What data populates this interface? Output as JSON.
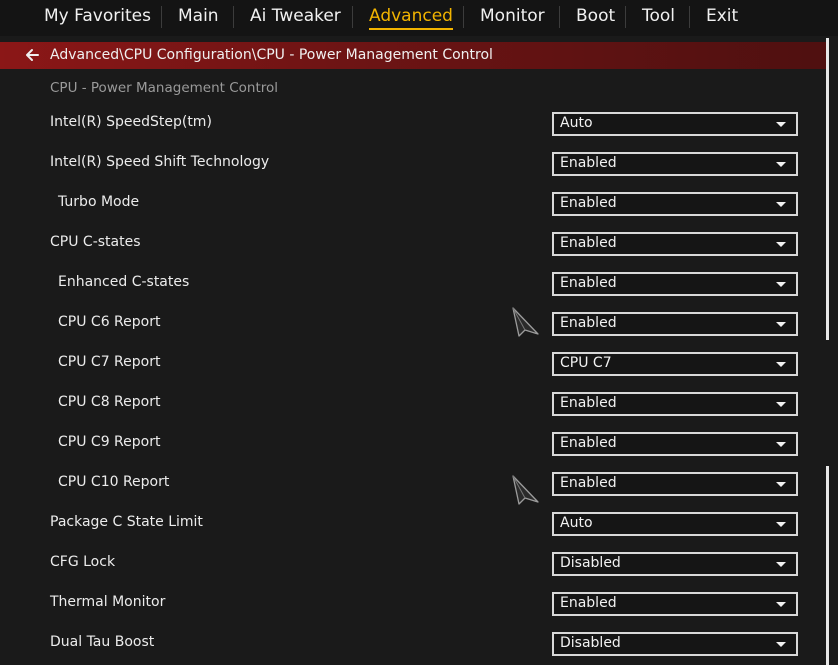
{
  "topnav": {
    "items": [
      {
        "label": "My Favorites"
      },
      {
        "label": "Main"
      },
      {
        "label": "Ai Tweaker"
      },
      {
        "label": "Advanced"
      },
      {
        "label": "Monitor"
      },
      {
        "label": "Boot"
      },
      {
        "label": "Tool"
      },
      {
        "label": "Exit"
      }
    ],
    "active": "Advanced",
    "active_color": "#f2b400"
  },
  "breadcrumb": {
    "path": "Advanced\\CPU Configuration\\CPU - Power Management Control",
    "back_icon": "arrow-left-icon",
    "bar_color": "#8b1717"
  },
  "section": {
    "title": "CPU - Power Management Control"
  },
  "settings": [
    {
      "label": "Intel(R) SpeedStep(tm)",
      "value": "Auto"
    },
    {
      "label": "Intel(R) Speed Shift Technology",
      "value": "Enabled"
    },
    {
      "label": "Turbo Mode",
      "value": "Enabled"
    },
    {
      "label": "CPU C-states",
      "value": "Enabled"
    },
    {
      "label": "Enhanced C-states",
      "value": "Enabled"
    },
    {
      "label": "CPU C6 Report",
      "value": "Enabled"
    },
    {
      "label": "CPU C7 Report",
      "value": "CPU C7"
    },
    {
      "label": "CPU C8 Report",
      "value": "Enabled"
    },
    {
      "label": "CPU C9 Report",
      "value": "Enabled"
    },
    {
      "label": "CPU C10 Report",
      "value": "Enabled"
    },
    {
      "label": "Package C State Limit",
      "value": "Auto"
    },
    {
      "label": "CFG Lock",
      "value": "Disabled"
    },
    {
      "label": "Thermal Monitor",
      "value": "Enabled"
    },
    {
      "label": "Dual Tau Boost",
      "value": "Disabled"
    }
  ]
}
